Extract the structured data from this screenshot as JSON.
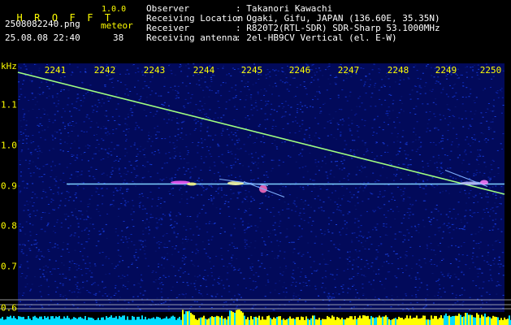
{
  "app": {
    "logo_letters": [
      "H",
      "R",
      "O",
      "F",
      "F",
      "T"
    ],
    "version": "1.0.0",
    "filename": "2508082240.png",
    "datetime": "25.08.08 22:40",
    "counter_label": "meteor",
    "counter_value": "38"
  },
  "info": [
    {
      "label": "Observer",
      "value": ": Takanori Kawachi"
    },
    {
      "label": "Receiving Location",
      "value": ": Ogaki, Gifu, JAPAN (136.60E, 35.35N)"
    },
    {
      "label": "Receiver",
      "value": ": R820T2(RTL-SDR) SDR-Sharp 53.1000MHz"
    },
    {
      "label": "Receiving antenna",
      "value": ": 2el-HB9CV Vertical (el. E-W)"
    }
  ],
  "axes": {
    "x_ticks": [
      "2241",
      "2242",
      "2243",
      "2244",
      "2245",
      "2246",
      "2247",
      "2248",
      "2249",
      "2250"
    ],
    "y_unit": "kHz",
    "y_ticks": [
      "1.1",
      "1.0",
      "0.9",
      "0.8",
      "0.7",
      "0.6"
    ],
    "y_range": [
      0.6,
      1.18
    ]
  },
  "colors": {
    "text_yellow": "#ffff00",
    "noise_blue": "#0a1e9c",
    "carrier_cyan": "#7fd0ff",
    "meteor_yellow": "#ffff40",
    "level_cyan": "#00dcff",
    "level_yellow": "#ffff00"
  },
  "signals": {
    "carrier_khz": 0.905,
    "drift_line": {
      "start_khz": 1.18,
      "end_khz": 0.88
    }
  }
}
